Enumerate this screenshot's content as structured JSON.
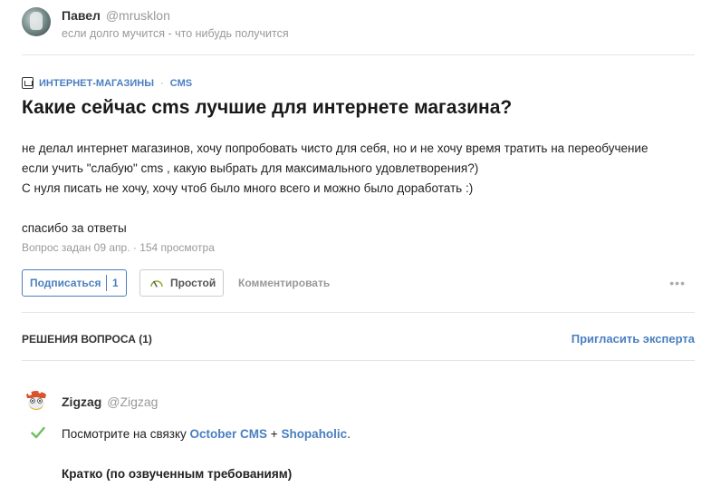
{
  "author": {
    "name": "Павел",
    "handle": "@mrusklon",
    "motto": "если долго мучится - что нибудь получится"
  },
  "tags": [
    "ИНТЕРНЕТ-МАГАЗИНЫ",
    "CMS"
  ],
  "tag_separator": "·",
  "question": {
    "title": "Какие сейчас cms лучшие для интернете магазина?",
    "body": [
      "не делал интернет магазинов, хочу попробовать чисто для себя, но и не хочу время тратить на переобучение",
      "если учить \"слабую\" cms , какую выбрать для максимального удовлетворения?)",
      "С нуля писать не хочу, хочу чтоб было много всего и можно было доработать :)",
      "",
      "спасибо за ответы"
    ],
    "meta": "Вопрос задан 09 апр. · 154 просмотра"
  },
  "actions": {
    "subscribe_label": "Подписаться",
    "subscribe_count": "1",
    "complexity_label": "Простой",
    "comment_label": "Комментировать",
    "more_label": "•••"
  },
  "solutions": {
    "header": "РЕШЕНИЯ ВОПРОСА (1)",
    "invite_label": "Пригласить эксперта"
  },
  "answer": {
    "author_name": "Zigzag",
    "author_handle": "@Zigzag",
    "text_before": "Посмотрите на связку ",
    "link1": "October CMS",
    "text_between": " + ",
    "link2": "Shopaholic",
    "text_after": ".",
    "subheading": "Кратко (по озвученным требованиям)"
  },
  "colors": {
    "accent": "#4a7fc0",
    "muted": "#999999",
    "check": "#6cbf5c",
    "gauge": "#8fb33a"
  },
  "icons": {
    "tag": "tag-icon",
    "gauge": "gauge-icon",
    "more": "more-icon",
    "check": "check-icon"
  }
}
